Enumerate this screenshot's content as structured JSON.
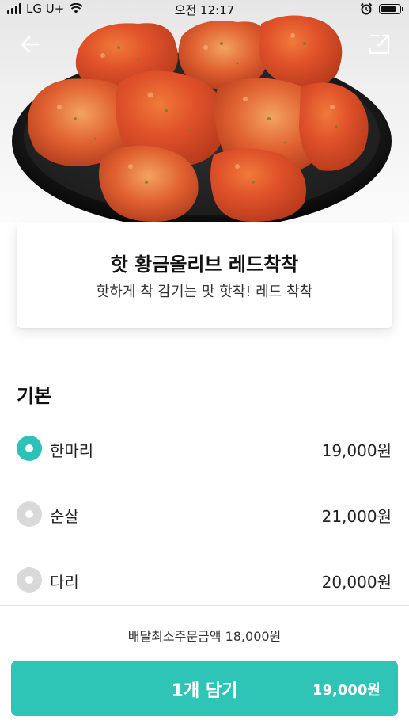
{
  "status_bar": {
    "carrier": "LG U+",
    "time": "오전 12:17"
  },
  "product": {
    "name": "핫 황금올리브 레드착착",
    "description": "핫하게 착 감기는 맛 핫착! 레드 착착"
  },
  "options": {
    "section_title": "기본",
    "selected_index": 0,
    "items": [
      {
        "label": "한마리",
        "price": "19,000원"
      },
      {
        "label": "순살",
        "price": "21,000원"
      },
      {
        "label": "다리",
        "price": "20,000원"
      }
    ]
  },
  "footer": {
    "min_order": "배달최소주문금액 18,000원",
    "cart_label": "1개 담기",
    "cart_price": "19,000원"
  },
  "icons": {
    "back": "arrow-left-icon",
    "share": "share-icon"
  },
  "colors": {
    "accent": "#2ec4b6",
    "radio_inactive": "#d9d9d9"
  }
}
